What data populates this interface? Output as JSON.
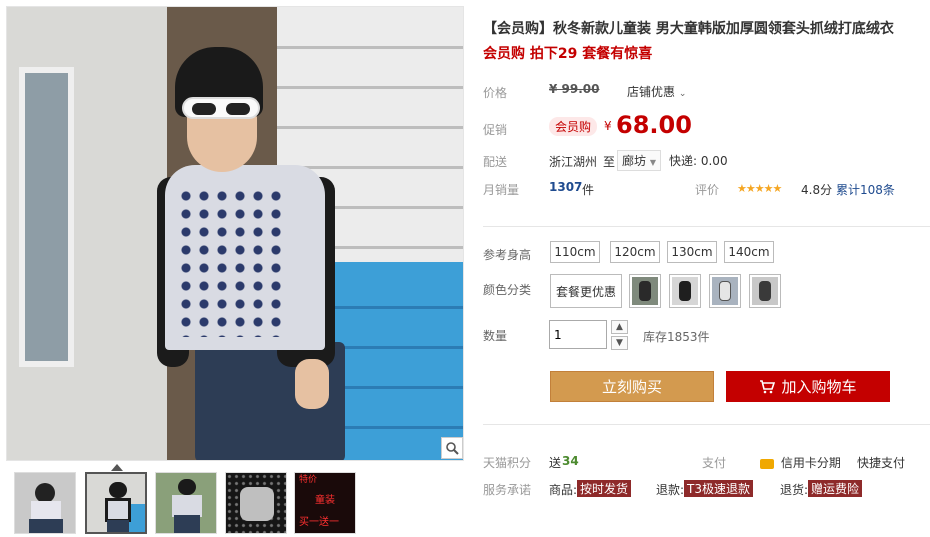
{
  "gallery": {
    "thumb_count": 5,
    "active_thumb": 2,
    "thumb_texts": {
      "five": [
        "特价",
        "童装",
        "买一送一"
      ]
    }
  },
  "product": {
    "title": "【会员购】秋冬新款儿童装 男大童韩版加厚圆领套头抓绒打底绒衣",
    "promo": "会员购 拍下29 套餐有惊喜"
  },
  "price": {
    "label": "价格",
    "original": "¥ 99.00",
    "store_promo": "店铺优惠",
    "promo_label": "促销",
    "promo_badge": "会员购",
    "currency": "¥",
    "current": "68.00"
  },
  "shipping": {
    "label": "配送",
    "from": "浙江湖州",
    "to_word": "至",
    "to": "廊坊",
    "express": "快递: 0.00"
  },
  "sales": {
    "label": "月销量",
    "count": "1307",
    "unit": "件",
    "rating_label": "评价",
    "stars": "★★★★★",
    "score": "4.8分",
    "reviews": "累计108条"
  },
  "sizes": {
    "label": "参考身高",
    "options": [
      "110cm",
      "120cm",
      "130cm",
      "140cm"
    ]
  },
  "colors": {
    "label": "颜色分类",
    "package": "套餐更优惠"
  },
  "quantity": {
    "label": "数量",
    "value": "1",
    "stock": "库存1853件"
  },
  "actions": {
    "buy_now": "立刻购买",
    "add_cart": "加入购物车"
  },
  "footer": {
    "points_label": "天猫积分",
    "points_value": "送",
    "points_num": "34",
    "pay_label": "支付",
    "credit": "信用卡分期",
    "fast_pay": "快捷支付",
    "service_label": "服务承诺",
    "goods": "商品:",
    "goods_tag": "按时发货",
    "refund": "退款:",
    "refund_tag": "T3极速退款",
    "return": "退货:",
    "return_tag": "赠运费险"
  },
  "colors_theme": {
    "accent_red": "#c40000",
    "buy_orange": "#d39a4f",
    "tag_brown": "#8e2a2a"
  }
}
